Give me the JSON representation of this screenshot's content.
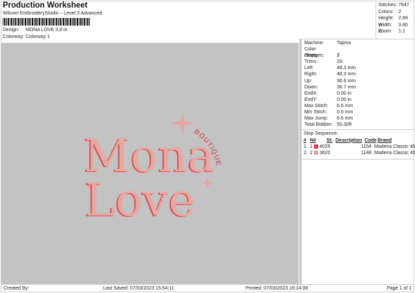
{
  "header": {
    "title": "Production Worksheet",
    "subtitle": "Wilcom EmbroideryStudio – Level 3 Advanced",
    "design_label": "Design:",
    "design": "MONA LOVE 3,8 in",
    "colorway_label": "Colorway:",
    "colorway": "Colorway 1"
  },
  "stats": [
    {
      "k": "Stitches:",
      "v": "7647"
    },
    {
      "k": "Colors:",
      "v": "2"
    },
    {
      "k": "Height:",
      "v": "2.89 in"
    },
    {
      "k": "Width:",
      "v": "3.80 in"
    },
    {
      "k": "Zoom:",
      "v": "1:1"
    }
  ],
  "props": [
    {
      "k": "Machine:",
      "v": "Tajima"
    },
    {
      "k": "Color changes:",
      "v": "1"
    },
    {
      "k": "Stops:",
      "v": "2"
    },
    {
      "k": "Trims:",
      "v": "29"
    },
    {
      "k": "Left:",
      "v": "48.3 mm"
    },
    {
      "k": "Right:",
      "v": "48.3 mm"
    },
    {
      "k": "Up:",
      "v": "36.6 mm"
    },
    {
      "k": "Down:",
      "v": "36.7 mm"
    },
    {
      "k": "EndX:",
      "v": "0.00 in"
    },
    {
      "k": "EndY:",
      "v": "0.00 in"
    },
    {
      "k": "Max Stitch:",
      "v": "6.6 mm"
    },
    {
      "k": "Min Stitch:",
      "v": "0.0 mm"
    },
    {
      "k": "Max Jump:",
      "v": "6.6 mm"
    },
    {
      "k": "Total Bobbin:",
      "v": "50.30ft"
    }
  ],
  "stop_sequence": {
    "title": "Stop Sequence:",
    "headers": [
      "#",
      "N#",
      "St.",
      "Description",
      "Code",
      "Brand"
    ],
    "rows": [
      {
        "n": "1.",
        "nn": "1",
        "color": "#d8374f",
        "st": "4025",
        "desc": "",
        "code": "1154",
        "brand": "Madeira Classic 40"
      },
      {
        "n": "2.",
        "nn": "2",
        "color": "#e3a0a3",
        "st": "3620",
        "desc": "",
        "code": "1148",
        "brand": "Madeira Classic 40"
      }
    ]
  },
  "design": {
    "line1": "Mona",
    "line2": "Love",
    "tag": "BOUTIQUE",
    "fill": "#eaa79f",
    "shade": "#c85560"
  },
  "footer": {
    "created": "Created By:",
    "saved": "Last Saved: 07/03/2023 15:54:11",
    "printed": "Printed: 07/03/2023 16:14:08",
    "page": "Page 1 of 1"
  }
}
